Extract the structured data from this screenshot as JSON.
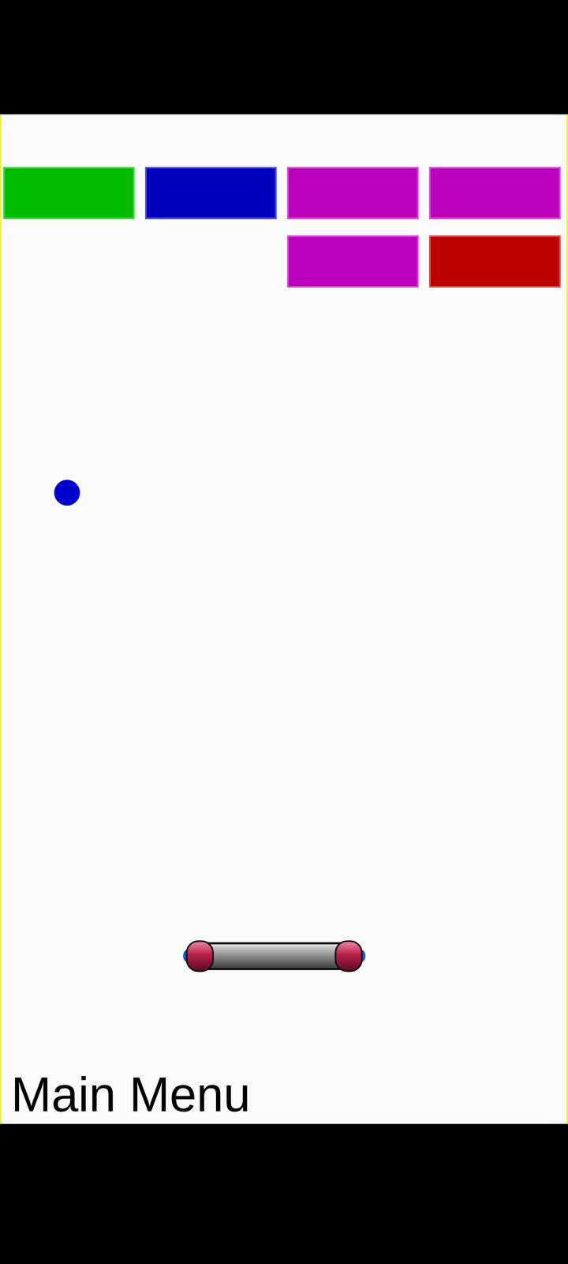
{
  "bricks": [
    [
      {
        "present": true,
        "color": "#00bb00"
      },
      {
        "present": true,
        "color": "#0000bb"
      },
      {
        "present": true,
        "color": "#bb00bb"
      },
      {
        "present": true,
        "color": "#bb00bb"
      }
    ],
    [
      {
        "present": false,
        "color": "#000000"
      },
      {
        "present": false,
        "color": "#000000"
      },
      {
        "present": true,
        "color": "#bb00bb"
      },
      {
        "present": true,
        "color": "#bb0000"
      }
    ]
  ],
  "menu": {
    "label": "Main Menu"
  }
}
